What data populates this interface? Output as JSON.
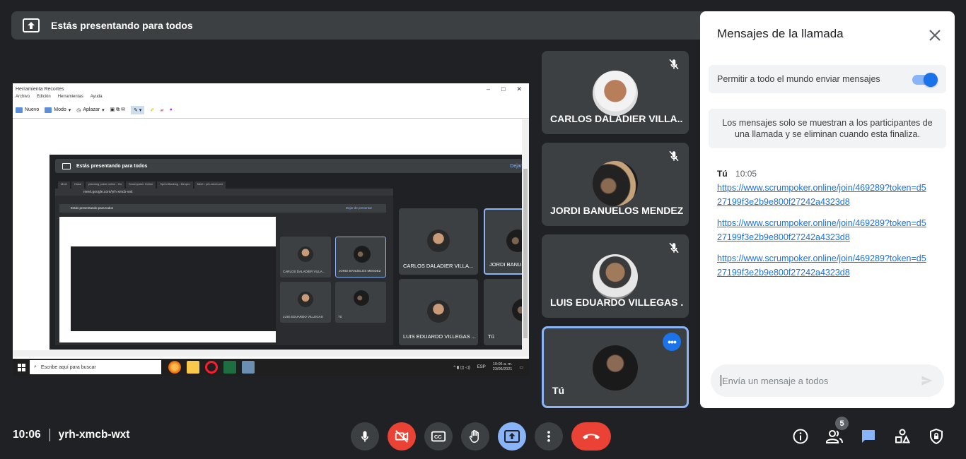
{
  "banner": {
    "text": "Estás presentando para todos"
  },
  "shared_screen": {
    "app_title": "Herramienta Recortes",
    "menu": [
      "Archivo",
      "Edición",
      "Herramientas",
      "Ayuda"
    ],
    "tools": {
      "new": "Nuevo",
      "mode": "Modo",
      "delay": "Aplazar"
    },
    "inner_banner": "Estás presentando para todos",
    "inner_stop": "Dejar",
    "inner_tabs": [
      "Meet",
      "Clase",
      "planning poker online - Go",
      "Scrumpoker Online",
      "Sprint Backlog - Dimpro",
      "Meet - yrh-xmcb-wxt"
    ],
    "inner_url": "meet.google.com/yrh-xmcb-wxt",
    "inner_banner2": "Estás presentando para todos",
    "inner_stop2": "Dejar de presentar",
    "inner_tiles": [
      "CARLOS DALADIER VILLA...",
      "JORDI BANUELOS MENDEZ",
      "LUIS EDUARDO VILLEGAS ...",
      "Tú"
    ],
    "mini_tiles": [
      "CARLOS DALADIER VILLA...",
      "JORDI BANUELOS MENDEZ",
      "LUIS EDUARDO VILLEGAS",
      "Tú"
    ],
    "taskbar": {
      "search": "Escribe aquí para buscar",
      "time": "10:06 a. m.",
      "date": "23/06/2021",
      "lang": "ESP"
    }
  },
  "participants": [
    {
      "name": "CARLOS DALADIER VILLA...",
      "muted": true
    },
    {
      "name": "JORDI BANUELOS MENDEZ",
      "muted": true
    },
    {
      "name": "LUIS EDUARDO VILLEGAS ...",
      "muted": true
    },
    {
      "name": "Tú",
      "muted": false
    }
  ],
  "chat": {
    "title": "Mensajes de la llamada",
    "allow_label": "Permitir a todo el mundo enviar mensajes",
    "allow_enabled": true,
    "notice": "Los mensajes solo se muestran a los participantes de una llamada y se eliminan cuando esta finaliza.",
    "sender": "Tú",
    "time": "10:05",
    "messages": [
      "https://www.scrumpoker.online/join/469289?token=d527199f3e2b9e800f27242a4323d8",
      "https://www.scrumpoker.online/join/469289?token=d527199f3e2b9e800f27242a4323d8",
      "https://www.scrumpoker.online/join/469289?token=d527199f3e2b9e800f27242a4323d8"
    ],
    "placeholder": "Envía un mensaje a todos"
  },
  "meeting": {
    "time": "10:06",
    "code": "yrh-xmcb-wxt"
  },
  "people_count": "5",
  "colors": {
    "background": "#202124",
    "tile": "#3c4043",
    "accent": "#8ab4f8",
    "danger": "#ea4335",
    "link": "#1a73e8"
  },
  "icons": [
    "present-icon",
    "mic-off-icon",
    "mic-icon",
    "camera-off-icon",
    "captions-icon",
    "raise-hand-icon",
    "present-now-icon",
    "more-vert-icon",
    "end-call-icon",
    "info-icon",
    "people-icon",
    "chat-icon",
    "activities-icon",
    "host-controls-icon",
    "close-icon",
    "send-icon"
  ]
}
